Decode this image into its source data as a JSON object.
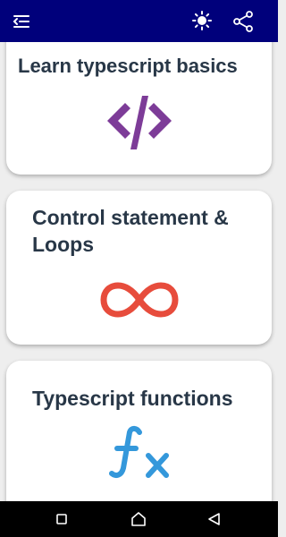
{
  "app_bar": {
    "background": "#00007b",
    "icons": [
      "menu-open-icon",
      "brightness-icon",
      "share-icon"
    ]
  },
  "cards": [
    {
      "title": "Learn typescript basics",
      "icon": "code-icon",
      "icon_color": "#7d3c98"
    },
    {
      "title": "Control statement & Loops",
      "icon": "infinity-icon",
      "icon_color": "#e74c3c"
    },
    {
      "title": "Typescript functions",
      "icon": "function-icon",
      "icon_color": "#3498db"
    }
  ],
  "nav_bar": {
    "icons": [
      "recent-apps-icon",
      "home-icon",
      "back-icon"
    ]
  }
}
